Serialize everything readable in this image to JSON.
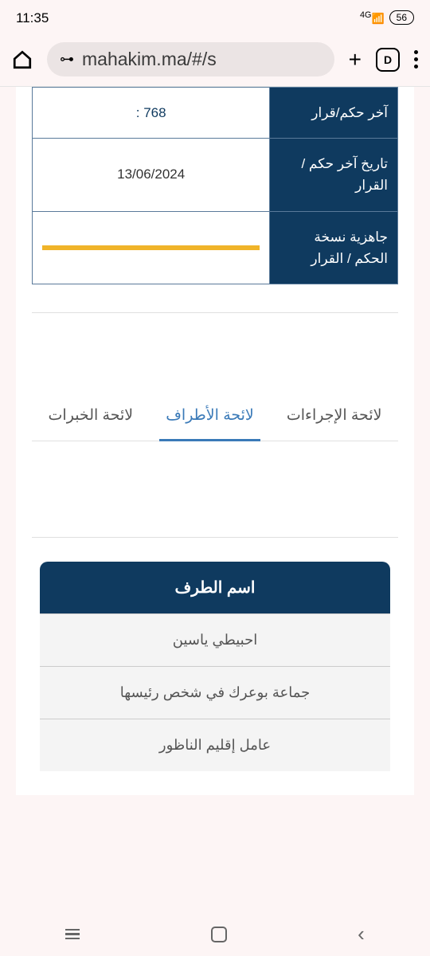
{
  "status": {
    "time": "11:35",
    "signal": "4G",
    "battery": "56"
  },
  "browser": {
    "url": "mahakim.ma/#/s",
    "tab_count": "D"
  },
  "info_rows": [
    {
      "label_top": "آخر حكم/قرار",
      "value_top": "768 :",
      "partial": true
    },
    {
      "label": "تاريخ آخر حكم / القرار",
      "value": "13/06/2024"
    },
    {
      "label": "جاهزية نسخة الحكم / القرار",
      "yellow": true
    }
  ],
  "tabs": [
    {
      "label": "لائحة الإجراءات",
      "active": false
    },
    {
      "label": "لائحة الأطراف",
      "active": true
    },
    {
      "label": "لائحة الخبرات",
      "active": false
    }
  ],
  "party": {
    "header": "اسم الطرف",
    "items": [
      "احبيطي ياسين",
      "جماعة بوعرك في شخص رئيسها",
      "عامل إقليم الناظور"
    ]
  }
}
